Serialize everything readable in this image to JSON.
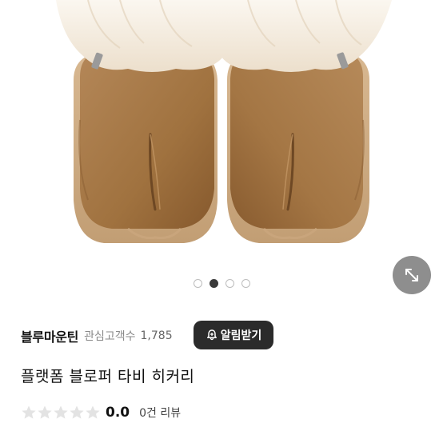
{
  "carousel": {
    "total": 4,
    "active_index": 1
  },
  "icons": {
    "expand": "expand-arrows-icon",
    "bell": "bell-icon",
    "star": "star-icon"
  },
  "seller": {
    "name": "블루마운틴",
    "followers_label": "관심고객수",
    "followers_count": "1,785"
  },
  "alarm_button": {
    "label": "알림받기"
  },
  "product": {
    "title": "플랫폼 블로퍼 타비 히커리"
  },
  "rating": {
    "stars_filled": 0,
    "stars_total": 5,
    "value": "0.0",
    "review_label": "0건 리뷰"
  },
  "colors": {
    "suede": "#a4764a",
    "fur": "#f6efe4",
    "button_dark": "#2b2b2b",
    "star_empty": "#e3e3e3"
  }
}
